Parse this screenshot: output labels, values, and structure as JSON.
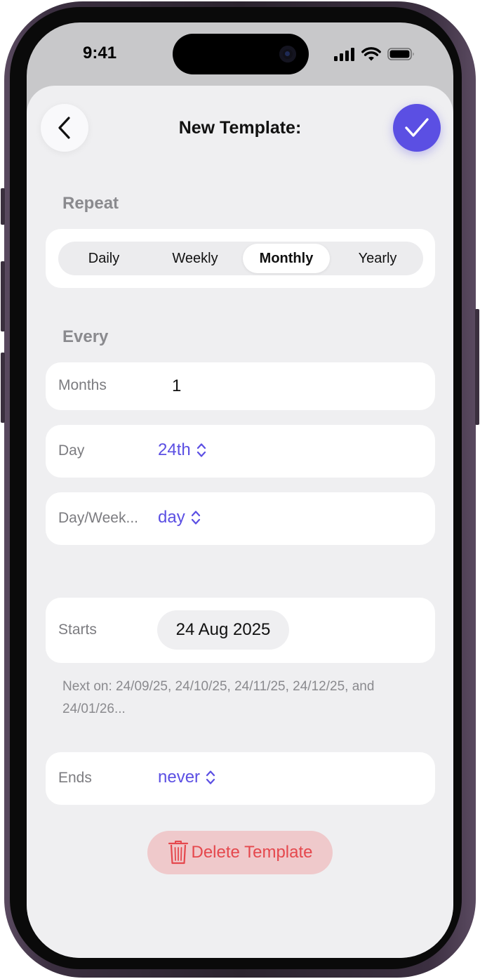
{
  "status_bar": {
    "time": "9:41",
    "icons": [
      "signal-icon",
      "wifi-icon",
      "battery-icon"
    ]
  },
  "header": {
    "title": "New Template:",
    "back_icon": "chevron-left-icon",
    "done_icon": "checkmark-icon"
  },
  "repeat": {
    "label": "Repeat",
    "options": [
      "Daily",
      "Weekly",
      "Monthly",
      "Yearly"
    ],
    "selected": "Monthly"
  },
  "every": {
    "label": "Every",
    "months_label": "Months",
    "months_value": "1",
    "day_label": "Day",
    "day_value": "24th",
    "dayweek_label": "Day/Week...",
    "dayweek_value": "day"
  },
  "starts": {
    "label": "Starts",
    "date": "24 Aug 2025"
  },
  "next_on": "Next on: 24/09/25, 24/10/25, 24/11/25, 24/12/25, and 24/01/26...",
  "ends": {
    "label": "Ends",
    "value": "never"
  },
  "delete_button": "Delete Template",
  "colors": {
    "accent": "#5b4fe3",
    "destructive": "#e5484d",
    "destructive_bg": "#efc9cb",
    "sheet_bg": "#efeff1"
  }
}
